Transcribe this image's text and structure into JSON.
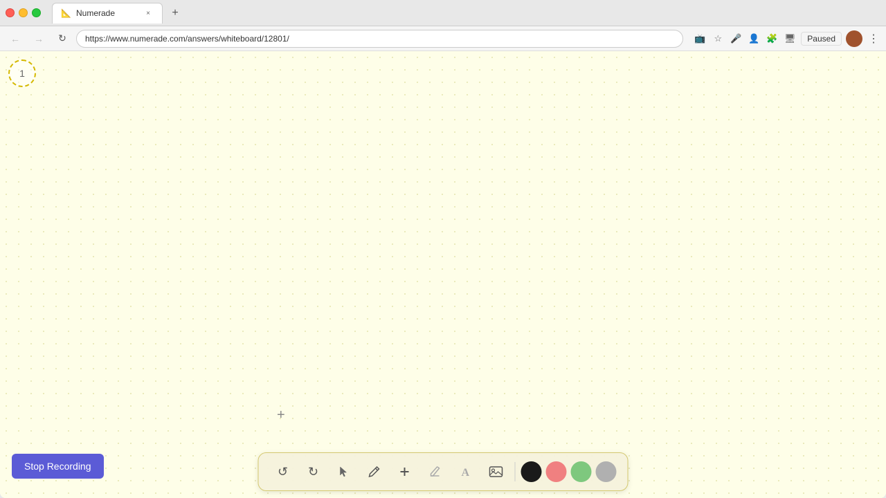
{
  "browser": {
    "tab": {
      "favicon": "📐",
      "title": "Numerade",
      "close_label": "×"
    },
    "new_tab_label": "+",
    "address": {
      "url": "https://www.numerade.com/answers/whiteboard/12801/",
      "back_icon": "←",
      "forward_icon": "→",
      "refresh_icon": "↻"
    },
    "paused_label": "Paused",
    "menu_label": "⋮"
  },
  "whiteboard": {
    "page_number": "1",
    "cursor_symbol": "+",
    "background_color": "#fefee8"
  },
  "stop_recording": {
    "label": "Stop Recording"
  },
  "toolbar": {
    "undo_label": "↺",
    "redo_label": "↻",
    "select_icon": "▲",
    "pen_icon": "✏",
    "plus_icon": "+",
    "eraser_icon": "/",
    "text_icon": "A",
    "image_icon": "🖼",
    "colors": {
      "black": "#1a1a1a",
      "pink": "#f08080",
      "green": "#7ec87e",
      "gray": "#b0b0b0"
    }
  }
}
